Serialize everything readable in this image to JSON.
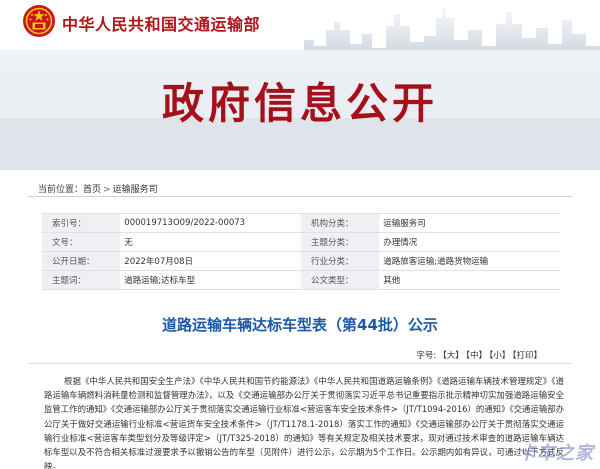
{
  "header": {
    "site_title": "中华人民共和国交通运输部"
  },
  "banner": {
    "title": "政府信息公开"
  },
  "breadcrumb": {
    "prefix": "当前位置：",
    "items": [
      "首页",
      "运输服务司"
    ],
    "separator": ">"
  },
  "info": {
    "rows": [
      {
        "l1": "索引号：",
        "v1": "000019713O09/2022-00073",
        "l2": "机构分类：",
        "v2": "运输服务司"
      },
      {
        "l1": "文号：",
        "v1": "无",
        "l2": "主题分类：",
        "v2": "办理情况"
      },
      {
        "l1": "公开日期：",
        "v1": "2022年07月08日",
        "l2": "行业分类：",
        "v2": "道路旅客运输;道路货物运输"
      },
      {
        "l1": "主题词：",
        "v1": "道路运输;达标车型",
        "l2": "公文类型：",
        "v2": "其他"
      }
    ]
  },
  "article": {
    "title": "道路运输车辆达标车型表（第44批）公示"
  },
  "fontbar": {
    "label": "字号:",
    "large": "【大】",
    "medium": "【中】",
    "small": "【小】",
    "print": "【打印】"
  },
  "body": {
    "paragraph": "根据《中华人民共和国安全生产法》《中华人民共和国节约能源法》《中华人民共和国道路运输条例》《道路运输车辆技术管理规定》《道路运输车辆燃料消耗量检测和监督管理办法》，以及《交通运输部办公厅关于贯彻落实习近平总书记重要指示批示精神切实加强道路运输安全监管工作的通知》《交通运输部办公厅关于贯彻落实交通运输行业标准<营运客车安全技术条件>（JT/T1094-2016）的通知》《交通运输部办公厅关于做好交通运输行业标准<营运货车安全技术条件>（JT/T1178.1-2018）落实工作的通知》《交通运输部办公厅关于贯彻落实交通运输行业标准<营运客车类型划分及等级评定>（JT/T325-2018）的通知》等有关规定及相关技术要求，现对通过技术审查的道路运输车辆达标车型以及不符合相关标准过渡要求予以撤销公告的车型（见附件）进行公示，公示期为5个工作日。公示期内如有异议，可通过以下方式反映。"
  },
  "watermark": {
    "text": "卡车之家"
  },
  "colors": {
    "brand_red": "#b3141a",
    "title_blue": "#1c5aa8",
    "banner_bg": "#e6eaef"
  }
}
